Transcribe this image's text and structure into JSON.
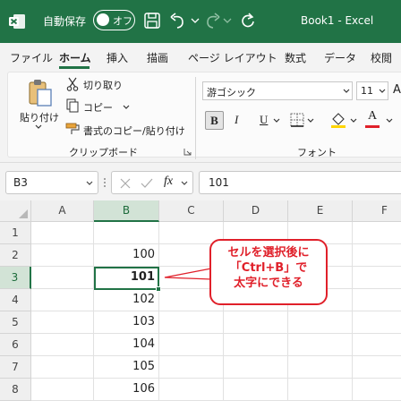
{
  "titlebar": {
    "autosave_label": "自動保存",
    "autosave_state": "オフ",
    "doc_title": "Book1  -  Excel",
    "accent": "#217346"
  },
  "menu": {
    "tabs": [
      "ファイル",
      "ホーム",
      "挿入",
      "描画",
      "ページ レイアウト",
      "数式",
      "データ",
      "校閲"
    ],
    "active": "ホーム"
  },
  "ribbon": {
    "paste_label": "貼り付け",
    "cut_label": "切り取り",
    "copy_label": "コピー",
    "format_painter_label": "書式のコピー/貼り付け",
    "clipboard_group": "クリップボード",
    "font_name": "游ゴシック",
    "font_size": "11",
    "bold_label": "B",
    "italic_label": "I",
    "underline_label": "U",
    "font_color_label": "A",
    "font_group": "フォント",
    "font_color": "#e0202a",
    "fill_color": "#ffd500"
  },
  "formula_bar": {
    "name_box": "B3",
    "fx_label": "fx",
    "value": "101"
  },
  "sheet": {
    "columns": [
      "A",
      "B",
      "C",
      "D",
      "E",
      "F"
    ],
    "selected_column": "B",
    "rows": [
      "1",
      "2",
      "3",
      "4",
      "5",
      "6",
      "7",
      "8"
    ],
    "selected_row": "3",
    "column_b_values": [
      "",
      "100",
      "101",
      "102",
      "103",
      "104",
      "105",
      "106"
    ],
    "active_cell": "B3"
  },
  "callout": {
    "line1": "セルを選択後に",
    "line2": "「Ctrl+B」で",
    "line3": "太字にできる",
    "color": "#e0202a"
  }
}
